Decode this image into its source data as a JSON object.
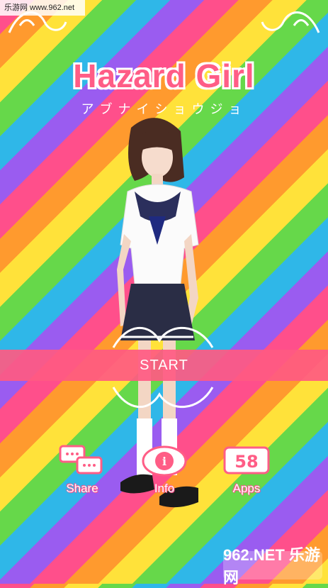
{
  "watermark": "乐游网 www.962.net",
  "title": "Hazard Girl",
  "subtitle": "アブナイショウジョ",
  "start_label": "START",
  "menu": {
    "share": {
      "label": "Share",
      "icon": "speech-bubbles-icon"
    },
    "info": {
      "label": "Info",
      "icon": "info-icon"
    },
    "apps": {
      "label": "Apps",
      "icon": "58-badge-icon",
      "badge": "58"
    }
  },
  "bottom_logo": "962.NET 乐游网",
  "colors": {
    "stripes": [
      "#ff4f8b",
      "#ff9a2e",
      "#ffe23a",
      "#66d84a",
      "#2fb7e8",
      "#9a5cf0"
    ],
    "accent": "#ff5d86",
    "start_bar": "#ff5a82"
  }
}
